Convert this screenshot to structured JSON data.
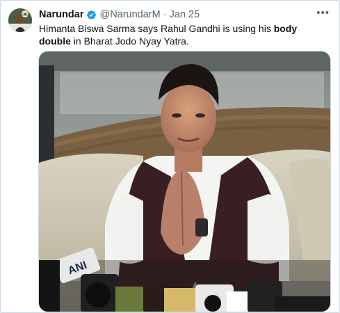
{
  "author": {
    "name": "Narundar",
    "handle": "@NarundarM",
    "separator": "·",
    "date": "Jan 25"
  },
  "tweet": {
    "text_part1": "Himanta Biswa Sarma says Rahul Gandhi is using his ",
    "text_bold": "body double",
    "text_part2": " in Bharat Jodo Nyay Yatra."
  },
  "media": {
    "mic_logo_text": "ANI"
  },
  "icons": [
    "verified-badge-icon",
    "more-options-icon"
  ],
  "colors": {
    "verified": "#1d9bf0",
    "secondary_text": "#536471",
    "border": "#cfd9de"
  }
}
